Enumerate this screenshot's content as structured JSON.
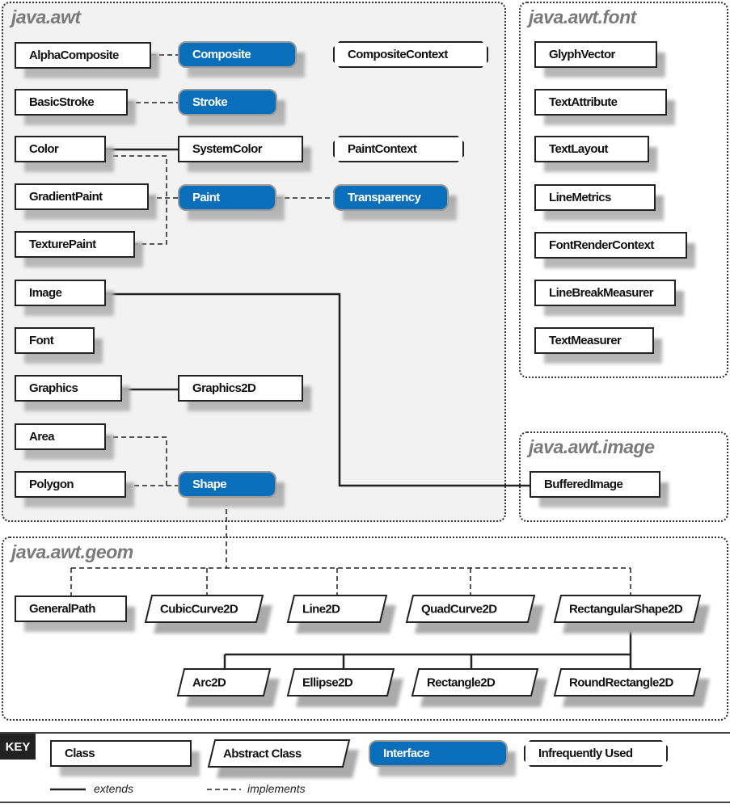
{
  "packages": {
    "awt": "java.awt",
    "font": "java.awt.font",
    "image": "java.awt.image",
    "geom": "java.awt.geom"
  },
  "nodes": {
    "AlphaComposite": "AlphaComposite",
    "Composite": "Composite",
    "CompositeContext": "CompositeContext",
    "BasicStroke": "BasicStroke",
    "Stroke": "Stroke",
    "Color": "Color",
    "SystemColor": "SystemColor",
    "PaintContext": "PaintContext",
    "GradientPaint": "GradientPaint",
    "Paint": "Paint",
    "Transparency": "Transparency",
    "TexturePaint": "TexturePaint",
    "Image": "Image",
    "Font": "Font",
    "Graphics": "Graphics",
    "Graphics2D": "Graphics2D",
    "Area": "Area",
    "Polygon": "Polygon",
    "Shape": "Shape",
    "GlyphVector": "GlyphVector",
    "TextAttribute": "TextAttribute",
    "TextLayout": "TextLayout",
    "LineMetrics": "LineMetrics",
    "FontRenderContext": "FontRenderContext",
    "LineBreakMeasurer": "LineBreakMeasurer",
    "TextMeasurer": "TextMeasurer",
    "BufferedImage": "BufferedImage",
    "GeneralPath": "GeneralPath",
    "CubicCurve2D": "CubicCurve2D",
    "Line2D": "Line2D",
    "QuadCurve2D": "QuadCurve2D",
    "RectangularShape2D": "RectangularShape2D",
    "Arc2D": "Arc2D",
    "Ellipse2D": "Ellipse2D",
    "Rectangle2D": "Rectangle2D",
    "RoundRectangle2D": "RoundRectangle2D"
  },
  "key": {
    "label": "KEY",
    "class": "Class",
    "abstract_class": "Abstract Class",
    "interface": "Interface",
    "infrequent": "Infrequently Used",
    "extends": "extends",
    "implements": "implements"
  },
  "colors": {
    "interface_fill": "#0a6fba",
    "package_title": "#7a7a7a"
  }
}
